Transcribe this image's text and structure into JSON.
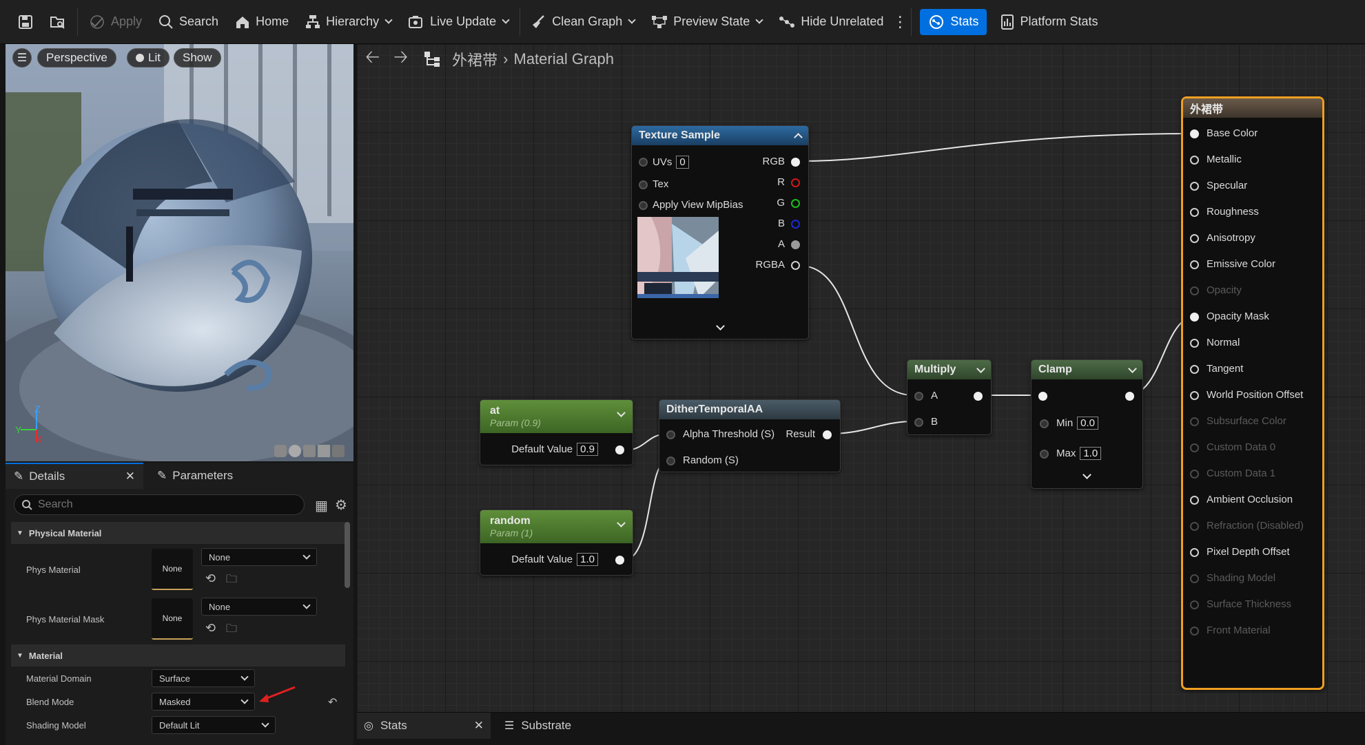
{
  "toolbar": {
    "apply": "Apply",
    "search": "Search",
    "home": "Home",
    "hierarchy": "Hierarchy",
    "live_update": "Live Update",
    "clean_graph": "Clean Graph",
    "preview_state": "Preview State",
    "hide_unrelated": "Hide Unrelated",
    "stats": "Stats",
    "platform_stats": "Platform Stats"
  },
  "viewport": {
    "perspective": "Perspective",
    "lit": "Lit",
    "show": "Show",
    "axis_z": "Z",
    "axis_y": "Y",
    "axis_x": "X"
  },
  "details": {
    "tab_details": "Details",
    "tab_parameters": "Parameters",
    "search_placeholder": "Search",
    "physical_material_section": "Physical Material",
    "phys_material_label": "Phys Material",
    "phys_material_thumb": "None",
    "phys_material_value": "None",
    "phys_material_mask_label": "Phys Material Mask",
    "phys_material_mask_thumb": "None",
    "phys_material_mask_value": "None",
    "material_section": "Material",
    "material_domain_label": "Material Domain",
    "material_domain_value": "Surface",
    "blend_mode_label": "Blend Mode",
    "blend_mode_value": "Masked",
    "shading_model_label": "Shading Model",
    "shading_model_value": "Default Lit"
  },
  "graph": {
    "breadcrumb_material": "外裙带",
    "breadcrumb_graph": "Material Graph",
    "texture_sample": {
      "title": "Texture Sample",
      "uvs_label": "UVs",
      "uvs_value": "0",
      "tex_label": "Tex",
      "mipbias_label": "Apply View MipBias",
      "rgb": "RGB",
      "r": "R",
      "g": "G",
      "b": "B",
      "a": "A",
      "rgba": "RGBA"
    },
    "param_at": {
      "title": "at",
      "subtitle": "Param (0.9)",
      "default_label": "Default Value",
      "default_value": "0.9"
    },
    "param_random": {
      "title": "random",
      "subtitle": "Param (1)",
      "default_label": "Default Value",
      "default_value": "1.0"
    },
    "dither": {
      "title": "DitherTemporalAA",
      "alpha_threshold": "Alpha Threshold (S)",
      "random": "Random (S)",
      "result": "Result"
    },
    "multiply": {
      "title": "Multiply",
      "a": "A",
      "b": "B"
    },
    "clamp": {
      "title": "Clamp",
      "min_label": "Min",
      "min_value": "0.0",
      "max_label": "Max",
      "max_value": "1.0"
    },
    "result_node": {
      "title": "外裙带",
      "pins": [
        {
          "label": "Base Color",
          "enabled": true
        },
        {
          "label": "Metallic",
          "enabled": true
        },
        {
          "label": "Specular",
          "enabled": true
        },
        {
          "label": "Roughness",
          "enabled": true
        },
        {
          "label": "Anisotropy",
          "enabled": true
        },
        {
          "label": "Emissive Color",
          "enabled": true
        },
        {
          "label": "Opacity",
          "enabled": false
        },
        {
          "label": "Opacity Mask",
          "enabled": true
        },
        {
          "label": "Normal",
          "enabled": true
        },
        {
          "label": "Tangent",
          "enabled": true
        },
        {
          "label": "World Position Offset",
          "enabled": true
        },
        {
          "label": "Subsurface Color",
          "enabled": false
        },
        {
          "label": "Custom Data 0",
          "enabled": false
        },
        {
          "label": "Custom Data 1",
          "enabled": false
        },
        {
          "label": "Ambient Occlusion",
          "enabled": true
        },
        {
          "label": "Refraction (Disabled)",
          "enabled": false
        },
        {
          "label": "Pixel Depth Offset",
          "enabled": true
        },
        {
          "label": "Shading Model",
          "enabled": false
        },
        {
          "label": "Surface Thickness",
          "enabled": false
        },
        {
          "label": "Front Material",
          "enabled": false
        }
      ]
    }
  },
  "bottom_tabs": {
    "stats": "Stats",
    "substrate": "Substrate"
  },
  "colors": {
    "accent_blue": "#0070e0",
    "selection_orange": "#f0a020",
    "pin_red": "#d01818",
    "pin_green": "#18c018",
    "pin_blue": "#1a2ad8"
  }
}
